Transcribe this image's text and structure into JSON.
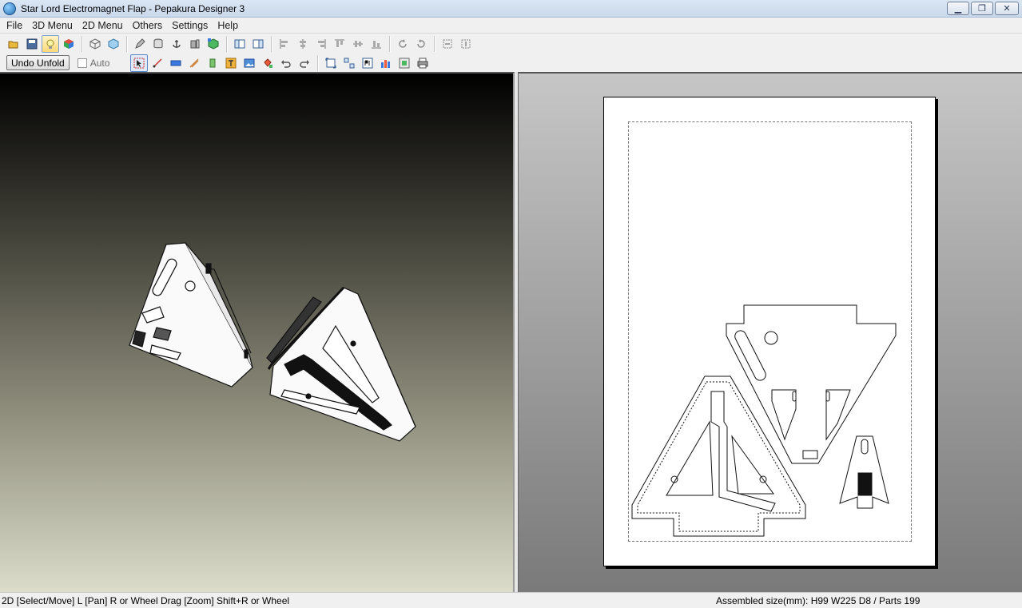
{
  "window": {
    "title": "Star Lord Electromagnet Flap - Pepakura Designer 3"
  },
  "menu": {
    "items": [
      "File",
      "3D Menu",
      "2D Menu",
      "Others",
      "Settings",
      "Help"
    ]
  },
  "toolbar2": {
    "undo_unfold": "Undo Unfold",
    "auto_label": "Auto",
    "auto_checked": false
  },
  "icons": {
    "toolbar1": [
      "open-file-icon",
      "save-icon",
      "light-bulb-icon",
      "color-cube-icon",
      "wireframe-cube-icon",
      "textured-cube-icon",
      "pencil-edit-icon",
      "cylinder-icon",
      "anchor-icon",
      "part-view-icon",
      "flip-cube-icon",
      "single-pane-icon",
      "dual-pane-icon",
      "align-left-icon",
      "align-center-icon",
      "align-right-icon",
      "align-top-icon",
      "align-middle-icon",
      "align-bottom-icon",
      "rotate-90-ccw-icon",
      "rotate-90-cw-icon",
      "fit-horizontal-icon",
      "fit-vertical-icon"
    ],
    "toolbar2": [
      "select-arrow-icon",
      "edge-tool-icon",
      "ruler-icon",
      "flap-edit-icon",
      "glue-tab-icon",
      "text-tool-icon",
      "image-icon",
      "paint-bucket-icon",
      "undo-icon",
      "redo-icon",
      "fit-page-icon",
      "arrange-icon",
      "page-number-icon",
      "layout-icon",
      "export-icon",
      "print-icon"
    ]
  },
  "status": {
    "hint": "2D [Select/Move] L [Pan] R or Wheel Drag [Zoom] Shift+R or Wheel",
    "assembled_size": "Assembled size(mm): H99 W225 D8 / Parts 199"
  }
}
